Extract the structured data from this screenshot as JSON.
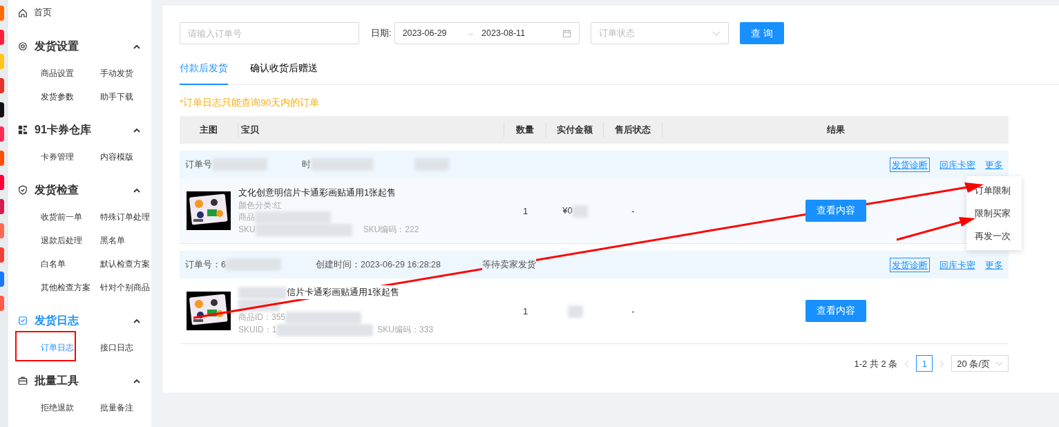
{
  "sidebar": {
    "home": {
      "label": "首页"
    },
    "groups": [
      {
        "title": "发货设置",
        "expanded": true,
        "selected": false,
        "items": [
          {
            "label": "商品设置",
            "selected": false
          },
          {
            "label": "手动发货",
            "selected": false
          },
          {
            "label": "发货参数",
            "selected": false
          },
          {
            "label": "助手下载",
            "selected": false
          }
        ]
      },
      {
        "title": "91卡券仓库",
        "expanded": true,
        "selected": false,
        "items": [
          {
            "label": "卡券管理",
            "selected": false
          },
          {
            "label": "内容模版",
            "selected": false
          }
        ]
      },
      {
        "title": "发货检查",
        "expanded": true,
        "selected": false,
        "items": [
          {
            "label": "收货前一单",
            "selected": false
          },
          {
            "label": "特殊订单处理",
            "selected": false
          },
          {
            "label": "退款后处理",
            "selected": false
          },
          {
            "label": "黑名单",
            "selected": false
          },
          {
            "label": "白名单",
            "selected": false
          },
          {
            "label": "默认检查方案",
            "selected": false
          },
          {
            "label": "其他检查方案",
            "selected": false
          },
          {
            "label": "针对个别商品",
            "selected": false
          }
        ]
      },
      {
        "title": "发货日志",
        "expanded": true,
        "selected": true,
        "items": [
          {
            "label": "订单日志",
            "selected": true
          },
          {
            "label": "接口日志",
            "selected": false
          }
        ]
      },
      {
        "title": "批量工具",
        "expanded": true,
        "selected": false,
        "items": [
          {
            "label": "拒绝退款",
            "selected": false
          },
          {
            "label": "批量备注",
            "selected": false
          }
        ]
      }
    ]
  },
  "filters": {
    "order_search": {
      "placeholder": "请输入订单号"
    },
    "date_label": "日期:",
    "date_start": "2023-06-29",
    "date_arrow": "→",
    "date_end": "2023-08-11",
    "status_select": {
      "placeholder": "订单状态"
    },
    "search_button": "查 询"
  },
  "tabs": [
    {
      "label": "付款后发货",
      "selected": true
    },
    {
      "label": "确认收货后赠送",
      "selected": false
    }
  ],
  "notice": "*订单日志只能查询90天内的订单",
  "table": {
    "columns": [
      "主图",
      "宝贝",
      "数量",
      "实付金额",
      "售后状态",
      "结果"
    ],
    "orders": [
      {
        "order_no": "订单号",
        "created": "时",
        "actions": [
          "发货诊断",
          "回库卡密",
          "更多"
        ],
        "item": {
          "title": "文化创意明信片卡通彩画贴通用1张起售",
          "spec": "颜色分类:红",
          "product_id": "商品",
          "skuid": "SKU",
          "sku_code": "SKU编码：222",
          "quantity": "1",
          "amount": "¥0",
          "after_sale": "-",
          "result_button": "查看内容"
        }
      },
      {
        "order_no": "订单号：6",
        "created": "创建时间：2023-06-29 16:28:28",
        "status": "等待卖家发货",
        "actions": [
          "发货诊断",
          "回库卡密",
          "更多"
        ],
        "item": {
          "title": "信片卡通彩画贴通用1张起售",
          "product_id": "商品ID：355",
          "skuid": "SKUID：1",
          "sku_code": "SKU编码：333",
          "quantity": "1",
          "after_sale": "-",
          "result_button": "查看内容"
        }
      }
    ]
  },
  "more_menu": [
    "订单限制",
    "限制买家",
    "再发一次"
  ],
  "pagination": {
    "summary": "1-2 共 2 条",
    "pages": [
      {
        "label": "1",
        "selected": true
      }
    ],
    "page_size": "20 条/页"
  }
}
